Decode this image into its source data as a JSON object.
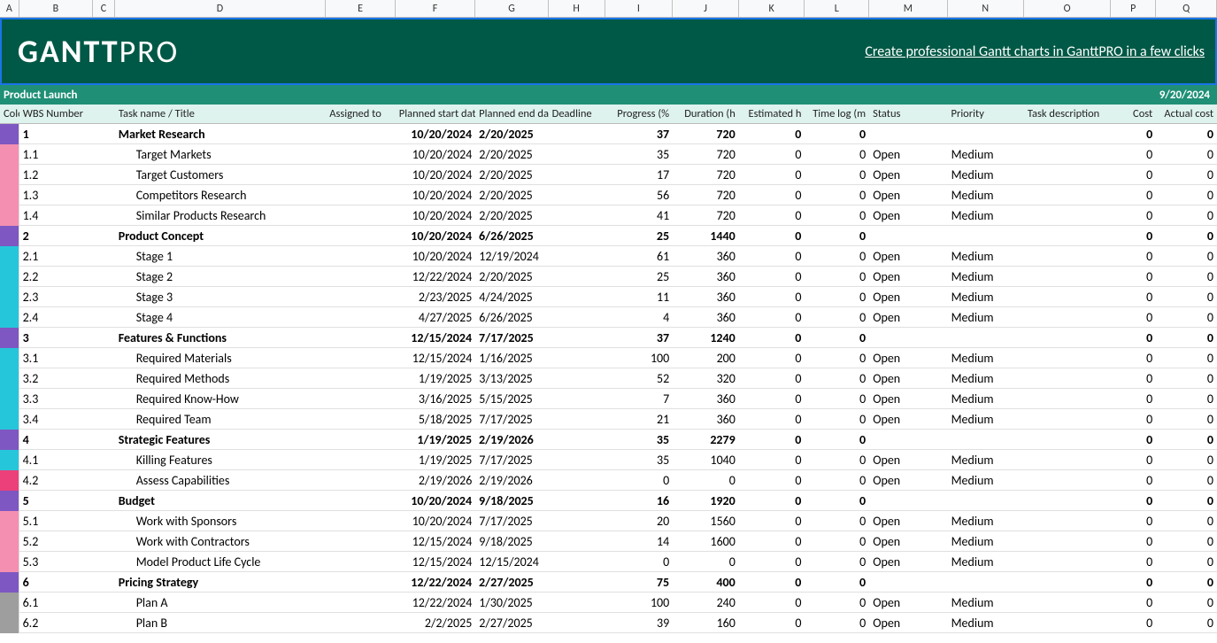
{
  "columns": [
    "A",
    "B",
    "C",
    "D",
    "E",
    "F",
    "G",
    "H",
    "I",
    "J",
    "K",
    "L",
    "M",
    "N",
    "O",
    "P",
    "Q"
  ],
  "logo": {
    "part1": "GANTT",
    "part2": "PRO"
  },
  "title_link": "Create professional Gantt charts in GanttPRO in a few clicks",
  "project": {
    "name": "Product Launch",
    "date": "9/20/2024"
  },
  "headers": {
    "A": "Color",
    "B": "WBS Number",
    "C": "",
    "D": "Task name / Title",
    "E": "Assigned to",
    "F": "Planned start date",
    "G": "Planned end date",
    "H": "Deadline",
    "I": "Progress (%",
    "J": "Duration (h",
    "K": "Estimated h",
    "L": "Time log (m",
    "M": "Status",
    "N": "Priority",
    "O": "Task description",
    "P": "Cost",
    "Q": "Actual cost"
  },
  "rows": [
    {
      "color": "#7e57c2",
      "wbs": "1",
      "task": "Market Research",
      "isGroup": true,
      "start": "10/20/2024",
      "end": "2/20/2025",
      "progress": "37",
      "duration": "720",
      "est": "0",
      "tlog": "0",
      "status": "",
      "priority": "",
      "cost": "0",
      "actual": "0"
    },
    {
      "color": "#f48fb1",
      "wbs": "1.1",
      "task": "Target Markets",
      "isGroup": false,
      "start": "10/20/2024",
      "end": "2/20/2025",
      "progress": "35",
      "duration": "720",
      "est": "0",
      "tlog": "0",
      "status": "Open",
      "priority": "Medium",
      "cost": "0",
      "actual": "0"
    },
    {
      "color": "#f48fb1",
      "wbs": "1.2",
      "task": "Target Customers",
      "isGroup": false,
      "start": "10/20/2024",
      "end": "2/20/2025",
      "progress": "17",
      "duration": "720",
      "est": "0",
      "tlog": "0",
      "status": "Open",
      "priority": "Medium",
      "cost": "0",
      "actual": "0"
    },
    {
      "color": "#f48fb1",
      "wbs": "1.3",
      "task": "Competitors Research",
      "isGroup": false,
      "start": "10/20/2024",
      "end": "2/20/2025",
      "progress": "56",
      "duration": "720",
      "est": "0",
      "tlog": "0",
      "status": "Open",
      "priority": "Medium",
      "cost": "0",
      "actual": "0"
    },
    {
      "color": "#f48fb1",
      "wbs": "1.4",
      "task": "Similar Products Research",
      "isGroup": false,
      "start": "10/20/2024",
      "end": "2/20/2025",
      "progress": "41",
      "duration": "720",
      "est": "0",
      "tlog": "0",
      "status": "Open",
      "priority": "Medium",
      "cost": "0",
      "actual": "0"
    },
    {
      "color": "#7e57c2",
      "wbs": "2",
      "task": "Product Concept",
      "isGroup": true,
      "start": "10/20/2024",
      "end": "6/26/2025",
      "progress": "25",
      "duration": "1440",
      "est": "0",
      "tlog": "0",
      "status": "",
      "priority": "",
      "cost": "0",
      "actual": "0"
    },
    {
      "color": "#26c6da",
      "wbs": "2.1",
      "task": "Stage 1",
      "isGroup": false,
      "start": "10/20/2024",
      "end": "12/19/2024",
      "progress": "61",
      "duration": "360",
      "est": "0",
      "tlog": "0",
      "status": "Open",
      "priority": "Medium",
      "cost": "0",
      "actual": "0"
    },
    {
      "color": "#26c6da",
      "wbs": "2.2",
      "task": "Stage 2",
      "isGroup": false,
      "start": "12/22/2024",
      "end": "2/20/2025",
      "progress": "25",
      "duration": "360",
      "est": "0",
      "tlog": "0",
      "status": "Open",
      "priority": "Medium",
      "cost": "0",
      "actual": "0"
    },
    {
      "color": "#26c6da",
      "wbs": "2.3",
      "task": "Stage 3",
      "isGroup": false,
      "start": "2/23/2025",
      "end": "4/24/2025",
      "progress": "11",
      "duration": "360",
      "est": "0",
      "tlog": "0",
      "status": "Open",
      "priority": "Medium",
      "cost": "0",
      "actual": "0"
    },
    {
      "color": "#26c6da",
      "wbs": "2.4",
      "task": "Stage 4",
      "isGroup": false,
      "start": "4/27/2025",
      "end": "6/26/2025",
      "progress": "4",
      "duration": "360",
      "est": "0",
      "tlog": "0",
      "status": "Open",
      "priority": "Medium",
      "cost": "0",
      "actual": "0"
    },
    {
      "color": "#7e57c2",
      "wbs": "3",
      "task": "Features & Functions",
      "isGroup": true,
      "start": "12/15/2024",
      "end": "7/17/2025",
      "progress": "37",
      "duration": "1240",
      "est": "0",
      "tlog": "0",
      "status": "",
      "priority": "",
      "cost": "0",
      "actual": "0"
    },
    {
      "color": "#26c6da",
      "wbs": "3.1",
      "task": "Required Materials",
      "isGroup": false,
      "start": "12/15/2024",
      "end": "1/16/2025",
      "progress": "100",
      "duration": "200",
      "est": "0",
      "tlog": "0",
      "status": "Open",
      "priority": "Medium",
      "cost": "0",
      "actual": "0"
    },
    {
      "color": "#26c6da",
      "wbs": "3.2",
      "task": "Required Methods",
      "isGroup": false,
      "start": "1/19/2025",
      "end": "3/13/2025",
      "progress": "52",
      "duration": "320",
      "est": "0",
      "tlog": "0",
      "status": "Open",
      "priority": "Medium",
      "cost": "0",
      "actual": "0"
    },
    {
      "color": "#26c6da",
      "wbs": "3.3",
      "task": "Required Know-How",
      "isGroup": false,
      "start": "3/16/2025",
      "end": "5/15/2025",
      "progress": "7",
      "duration": "360",
      "est": "0",
      "tlog": "0",
      "status": "Open",
      "priority": "Medium",
      "cost": "0",
      "actual": "0"
    },
    {
      "color": "#26c6da",
      "wbs": "3.4",
      "task": "Required Team",
      "isGroup": false,
      "start": "5/18/2025",
      "end": "7/17/2025",
      "progress": "21",
      "duration": "360",
      "est": "0",
      "tlog": "0",
      "status": "Open",
      "priority": "Medium",
      "cost": "0",
      "actual": "0"
    },
    {
      "color": "#7e57c2",
      "wbs": "4",
      "task": "Strategic Features",
      "isGroup": true,
      "start": "1/19/2025",
      "end": "2/19/2026",
      "progress": "35",
      "duration": "2279",
      "est": "0",
      "tlog": "0",
      "status": "",
      "priority": "",
      "cost": "0",
      "actual": "0"
    },
    {
      "color": "#26c6da",
      "wbs": "4.1",
      "task": "Killing Features",
      "isGroup": false,
      "start": "1/19/2025",
      "end": "7/17/2025",
      "progress": "35",
      "duration": "1040",
      "est": "0",
      "tlog": "0",
      "status": "Open",
      "priority": "Medium",
      "cost": "0",
      "actual": "0"
    },
    {
      "color": "#ec407a",
      "wbs": "4.2",
      "task": "Assess Capabilities",
      "isGroup": false,
      "start": "2/19/2026",
      "end": "2/19/2026",
      "progress": "0",
      "duration": "0",
      "est": "0",
      "tlog": "0",
      "status": "Open",
      "priority": "Medium",
      "cost": "0",
      "actual": "0"
    },
    {
      "color": "#7e57c2",
      "wbs": "5",
      "task": "Budget",
      "isGroup": true,
      "start": "10/20/2024",
      "end": "9/18/2025",
      "progress": "16",
      "duration": "1920",
      "est": "0",
      "tlog": "0",
      "status": "",
      "priority": "",
      "cost": "0",
      "actual": "0"
    },
    {
      "color": "#f48fb1",
      "wbs": "5.1",
      "task": "Work with Sponsors",
      "isGroup": false,
      "start": "10/20/2024",
      "end": "7/17/2025",
      "progress": "20",
      "duration": "1560",
      "est": "0",
      "tlog": "0",
      "status": "Open",
      "priority": "Medium",
      "cost": "0",
      "actual": "0"
    },
    {
      "color": "#f48fb1",
      "wbs": "5.2",
      "task": "Work with Contractors",
      "isGroup": false,
      "start": "12/15/2024",
      "end": "9/18/2025",
      "progress": "14",
      "duration": "1600",
      "est": "0",
      "tlog": "0",
      "status": "Open",
      "priority": "Medium",
      "cost": "0",
      "actual": "0"
    },
    {
      "color": "#f48fb1",
      "wbs": "5.3",
      "task": "Model Product Life Cycle",
      "isGroup": false,
      "start": "12/15/2024",
      "end": "12/15/2024",
      "progress": "0",
      "duration": "0",
      "est": "0",
      "tlog": "0",
      "status": "Open",
      "priority": "Medium",
      "cost": "0",
      "actual": "0"
    },
    {
      "color": "#7e57c2",
      "wbs": "6",
      "task": "Pricing Strategy",
      "isGroup": true,
      "start": "12/22/2024",
      "end": "2/27/2025",
      "progress": "75",
      "duration": "400",
      "est": "0",
      "tlog": "0",
      "status": "",
      "priority": "",
      "cost": "0",
      "actual": "0"
    },
    {
      "color": "#9e9e9e",
      "wbs": "6.1",
      "task": "Plan A",
      "isGroup": false,
      "start": "12/22/2024",
      "end": "1/30/2025",
      "progress": "100",
      "duration": "240",
      "est": "0",
      "tlog": "0",
      "status": "Open",
      "priority": "Medium",
      "cost": "0",
      "actual": "0"
    },
    {
      "color": "#9e9e9e",
      "wbs": "6.2",
      "task": "Plan B",
      "isGroup": false,
      "start": "2/2/2025",
      "end": "2/27/2025",
      "progress": "39",
      "duration": "160",
      "est": "0",
      "tlog": "0",
      "status": "Open",
      "priority": "Medium",
      "cost": "0",
      "actual": "0"
    }
  ]
}
